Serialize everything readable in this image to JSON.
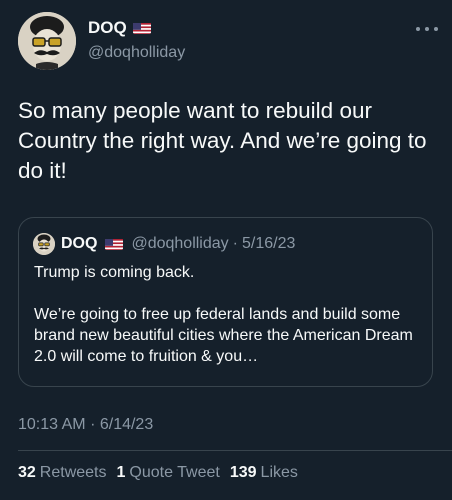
{
  "colors": {
    "background": "#15202b",
    "text_primary": "#f7f9f9",
    "text_secondary": "#8b98a5",
    "border": "#38444d"
  },
  "author": {
    "name": "DOQ",
    "flag_icon": "us-flag-icon",
    "handle": "@doqholliday",
    "avatar_icon": "mustache-man-sunglasses-avatar"
  },
  "more_icon": "more-horizontal-icon",
  "tweet": {
    "text": "So many people want to rebuild our Country the right way. And we’re going to do it!"
  },
  "quoted_tweet": {
    "name": "DOQ",
    "flag_icon": "us-flag-icon",
    "handle": "@doqholliday",
    "separator": "·",
    "date": "5/16/23",
    "paragraphs": [
      "Trump is coming back.",
      "We’re going to free up federal lands and build some brand new beautiful cities where the American Dream 2.0 will come to fruition & you…"
    ]
  },
  "meta": {
    "time": "10:13 AM",
    "separator": "·",
    "date": "6/14/23"
  },
  "stats": {
    "retweets_count": "32",
    "retweets_label": "Retweets",
    "quote_count": "1",
    "quote_label": "Quote Tweet",
    "likes_count": "139",
    "likes_label": "Likes"
  }
}
